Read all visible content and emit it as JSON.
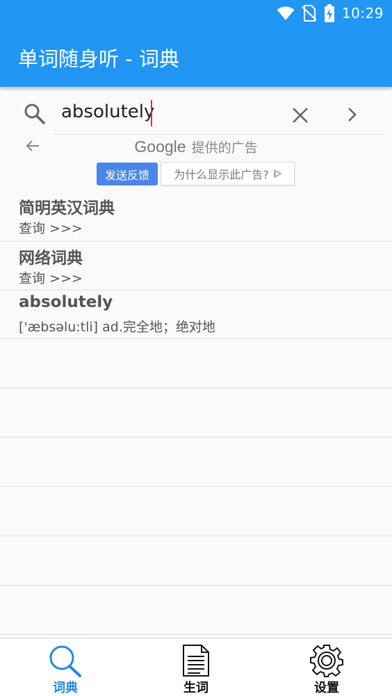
{
  "status_bar": {
    "time": "10:29"
  },
  "app_bar": {
    "title": "单词随身听 - 词典"
  },
  "search": {
    "value": "absolutely"
  },
  "ad": {
    "google": "Google",
    "provided_by": "提供的广告",
    "feedback_label": "发送反馈",
    "why_label": "为什么显示此广告?"
  },
  "results": [
    {
      "title": "简明英汉词典",
      "subtitle": "查询 >>>"
    },
    {
      "title": "网络词典",
      "subtitle": "查询 >>>"
    },
    {
      "title": "absolutely",
      "subtitle": "['æbsəlu:tli] ad.完全地；绝对地"
    }
  ],
  "bottom_nav": {
    "items": [
      {
        "label": "词典",
        "icon": "search-icon",
        "active": true
      },
      {
        "label": "生词",
        "icon": "document-icon",
        "active": false
      },
      {
        "label": "设置",
        "icon": "gear-icon",
        "active": false
      }
    ]
  },
  "colors": {
    "primary": "#2196f3",
    "accent": "#e91e63",
    "active_nav": "#1e88e5"
  }
}
